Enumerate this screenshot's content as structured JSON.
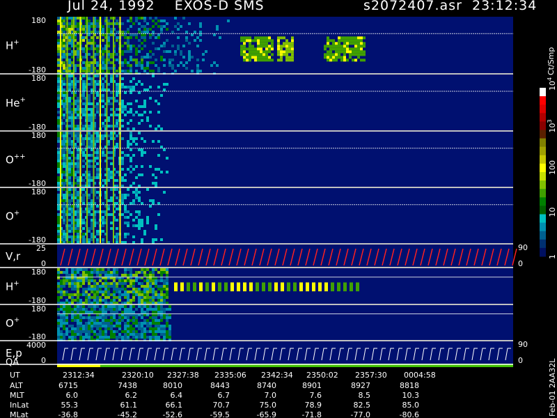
{
  "header": {
    "left_title": "Jul 24, 1992    EXOS-D SMS",
    "right_title": "s2072407.asr  23:12:34"
  },
  "panels": [
    {
      "label": "H",
      "sup": "+",
      "ymax": "180",
      "ymin": "-180"
    },
    {
      "label": "He",
      "sup": "+",
      "ymax": "180",
      "ymin": "-180"
    },
    {
      "label": "O",
      "sup": "++",
      "ymax": "180",
      "ymin": "-180"
    },
    {
      "label": "O",
      "sup": "+",
      "ymax": "180",
      "ymin": "-180"
    },
    {
      "label": "V,r",
      "sup": "",
      "ymax": "25",
      "ymin": "0",
      "right_top": "90",
      "right_bottom": "0"
    },
    {
      "label": "H",
      "sup": "+",
      "ymax": "180",
      "ymin": "-180"
    },
    {
      "label": "O",
      "sup": "+",
      "ymax": "180",
      "ymin": "-180"
    },
    {
      "label": "E,p",
      "sup": "",
      "ymax": "4000",
      "ymin": "0",
      "right_top": "90",
      "right_bottom": "0",
      "label2": "QA"
    }
  ],
  "colorbar": {
    "unit": "Ct/Smp",
    "ticks": [
      {
        "text": "10",
        "sup": "4",
        "pos": 0.0
      },
      {
        "text": "10",
        "sup": "3",
        "pos": 0.25
      },
      {
        "text": "100",
        "sup": "",
        "pos": 0.5
      },
      {
        "text": "10",
        "sup": "",
        "pos": 0.75
      },
      {
        "text": "1",
        "sup": "",
        "pos": 1.0
      }
    ],
    "colors": [
      "#ffffff",
      "#ff0000",
      "#dd0000",
      "#b00000",
      "#8a0000",
      "#5a2000",
      "#808000",
      "#a0a000",
      "#c8c800",
      "#ffff00",
      "#c8e000",
      "#80c000",
      "#40a000",
      "#008000",
      "#006000",
      "#00c0c0",
      "#0090b0",
      "#006090",
      "#003070",
      "#001060"
    ]
  },
  "footer_label": "Feb-01  2AA32L",
  "time_axis": {
    "row_labels": [
      "UT",
      "ALT",
      "MLT",
      "InLat",
      "MLat"
    ],
    "columns": [
      [
        "2312:34",
        "6715",
        "6.0",
        "55.3",
        "-36.8"
      ],
      [
        "2320:10",
        "7438",
        "6.2",
        "61.1",
        "-45.2"
      ],
      [
        "2327:38",
        "8010",
        "6.4",
        "66.1",
        "-52.6"
      ],
      [
        "2335:06",
        "8443",
        "6.7",
        "70.7",
        "-59.5"
      ],
      [
        "2342:34",
        "8740",
        "7.0",
        "75.0",
        "-65.9"
      ],
      [
        "2350:02",
        "8901",
        "7.6",
        "78.9",
        "-71.8"
      ],
      [
        "2357:30",
        "8927",
        "8.5",
        "82.5",
        "-77.0"
      ],
      [
        "0004:58",
        "8818",
        "10.3",
        "85.0",
        "-80.6"
      ]
    ]
  },
  "colors": {
    "background": "#000000",
    "plot_bg": "#001070",
    "separator": "#ffffff"
  }
}
